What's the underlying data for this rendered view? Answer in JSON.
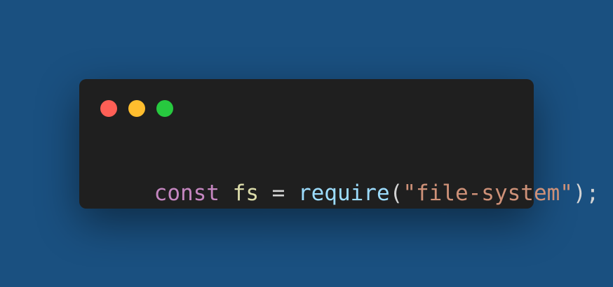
{
  "window_controls": [
    {
      "name": "close",
      "color": "#ff5f56"
    },
    {
      "name": "minimize",
      "color": "#ffbd2e"
    },
    {
      "name": "maximize",
      "color": "#27c93f"
    }
  ],
  "code": {
    "tokens": [
      {
        "text": "const",
        "color": "#c586c0"
      },
      {
        "text": " ",
        "color": "#d4d4d4"
      },
      {
        "text": "fs",
        "color": "#dcdcaa"
      },
      {
        "text": " = ",
        "color": "#d4d4d4"
      },
      {
        "text": "require",
        "color": "#9cdcfe"
      },
      {
        "text": "(",
        "color": "#d4d4d4"
      },
      {
        "text": "\"file-system\"",
        "color": "#ce9178"
      },
      {
        "text": ");",
        "color": "#d4d4d4"
      }
    ]
  }
}
